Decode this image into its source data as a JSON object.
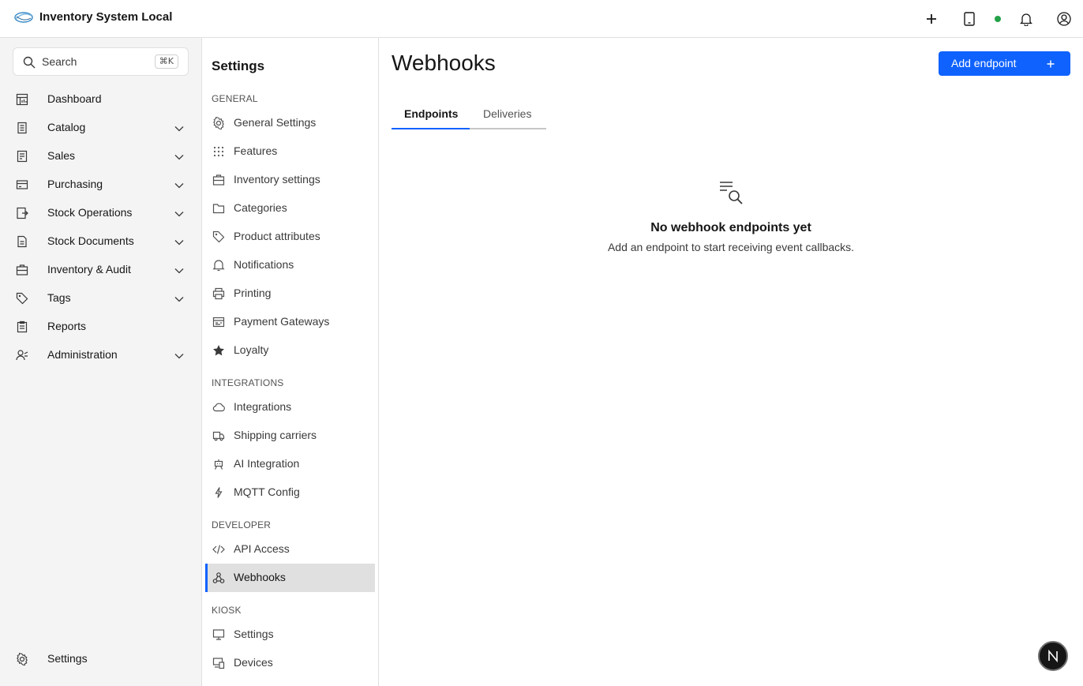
{
  "header": {
    "app_title": "Inventory System Local",
    "icons": [
      "add-icon",
      "tablet-icon",
      "status-dot",
      "notification-icon",
      "user-avatar-icon"
    ],
    "status_color": "#24a148"
  },
  "sidebar": {
    "search_label": "Search",
    "search_shortcut": "⌘K",
    "items": [
      {
        "label": "Dashboard",
        "icon": "dashboard-icon",
        "expandable": false
      },
      {
        "label": "Catalog",
        "icon": "catalog-icon",
        "expandable": true
      },
      {
        "label": "Sales",
        "icon": "sales-icon",
        "expandable": true
      },
      {
        "label": "Purchasing",
        "icon": "purchasing-icon",
        "expandable": true
      },
      {
        "label": "Stock Operations",
        "icon": "stock-operations-icon",
        "expandable": true
      },
      {
        "label": "Stock Documents",
        "icon": "stock-documents-icon",
        "expandable": true
      },
      {
        "label": "Inventory & Audit",
        "icon": "inventory-audit-icon",
        "expandable": true
      },
      {
        "label": "Tags",
        "icon": "tag-icon",
        "expandable": true
      },
      {
        "label": "Reports",
        "icon": "reports-icon",
        "expandable": false
      },
      {
        "label": "Administration",
        "icon": "administration-icon",
        "expandable": true
      }
    ],
    "footer_label": "Settings"
  },
  "settings_nav": {
    "title": "Settings",
    "sections": [
      {
        "heading": "GENERAL",
        "items": [
          {
            "label": "General Settings",
            "icon": "gear-icon"
          },
          {
            "label": "Features",
            "icon": "grid-icon"
          },
          {
            "label": "Inventory settings",
            "icon": "inventory-icon"
          },
          {
            "label": "Categories",
            "icon": "folder-icon"
          },
          {
            "label": "Product attributes",
            "icon": "tag-icon"
          },
          {
            "label": "Notifications",
            "icon": "bell-icon"
          },
          {
            "label": "Printing",
            "icon": "printer-icon"
          },
          {
            "label": "Payment Gateways",
            "icon": "payment-icon"
          },
          {
            "label": "Loyalty",
            "icon": "star-icon"
          }
        ]
      },
      {
        "heading": "INTEGRATIONS",
        "items": [
          {
            "label": "Integrations",
            "icon": "cloud-icon"
          },
          {
            "label": "Shipping carriers",
            "icon": "truck-icon"
          },
          {
            "label": "AI Integration",
            "icon": "robot-icon"
          },
          {
            "label": "MQTT Config",
            "icon": "lightning-icon"
          }
        ]
      },
      {
        "heading": "DEVELOPER",
        "items": [
          {
            "label": "API Access",
            "icon": "code-icon"
          },
          {
            "label": "Webhooks",
            "icon": "webhook-icon",
            "active": true
          }
        ]
      },
      {
        "heading": "KIOSK",
        "items": [
          {
            "label": "Settings",
            "icon": "monitor-icon"
          },
          {
            "label": "Devices",
            "icon": "devices-icon"
          }
        ]
      }
    ]
  },
  "main": {
    "title": "Webhooks",
    "add_button_label": "Add endpoint",
    "tabs": [
      {
        "label": "Endpoints",
        "active": true
      },
      {
        "label": "Deliveries",
        "active": false
      }
    ],
    "empty_title": "No webhook endpoints yet",
    "empty_subtitle": "Add an endpoint to start receiving event callbacks."
  },
  "fab_label": "N",
  "colors": {
    "accent": "#0f62fe",
    "active_bg": "#e0e0e0",
    "sidebar_bg": "#f4f4f4"
  }
}
